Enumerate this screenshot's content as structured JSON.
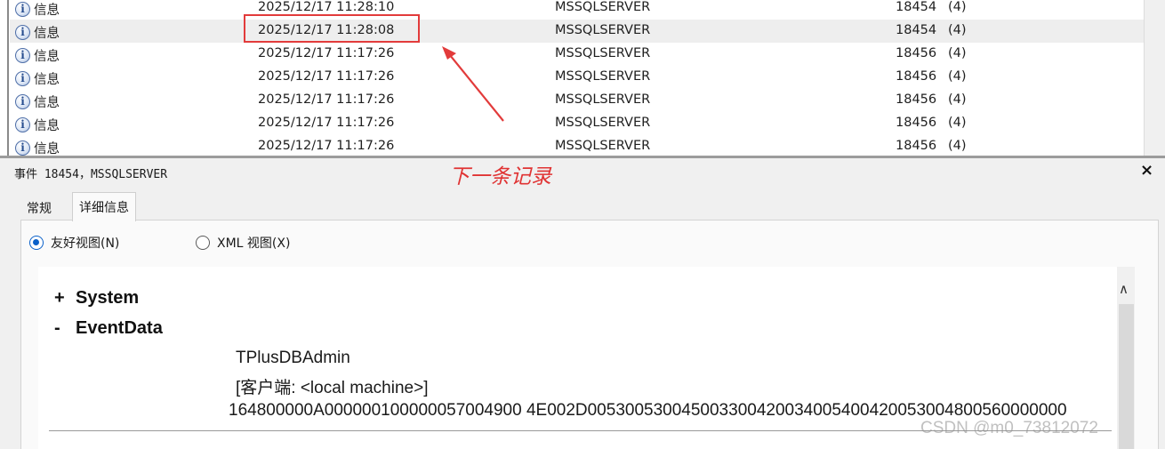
{
  "event_list": {
    "rows": [
      {
        "level": "信息",
        "datetime": "2025/12/17 11:28:10",
        "source": "MSSQLSERVER",
        "event_id": "18454",
        "task": "(4)"
      },
      {
        "level": "信息",
        "datetime": "2025/12/17 11:28:08",
        "source": "MSSQLSERVER",
        "event_id": "18454",
        "task": "(4)"
      },
      {
        "level": "信息",
        "datetime": "2025/12/17 11:17:26",
        "source": "MSSQLSERVER",
        "event_id": "18456",
        "task": "(4)"
      },
      {
        "level": "信息",
        "datetime": "2025/12/17 11:17:26",
        "source": "MSSQLSERVER",
        "event_id": "18456",
        "task": "(4)"
      },
      {
        "level": "信息",
        "datetime": "2025/12/17 11:17:26",
        "source": "MSSQLSERVER",
        "event_id": "18456",
        "task": "(4)"
      },
      {
        "level": "信息",
        "datetime": "2025/12/17 11:17:26",
        "source": "MSSQLSERVER",
        "event_id": "18456",
        "task": "(4)"
      },
      {
        "level": "信息",
        "datetime": "2025/12/17 11:17:26",
        "source": "MSSQLSERVER",
        "event_id": "18456",
        "task": "(4)"
      }
    ],
    "level_icon": "info-icon"
  },
  "annotation": {
    "text": "下一条记录",
    "color": "#e03333"
  },
  "detail": {
    "title": "事件 18454，MSSQLSERVER",
    "close_label": "×",
    "tabs": [
      {
        "label": "常规"
      },
      {
        "label": "详细信息"
      }
    ],
    "views": {
      "friendly": "友好视图(N)",
      "xml": "XML 视图(X)"
    },
    "tree": {
      "system": {
        "sign": "+",
        "label": "System"
      },
      "event_data": {
        "sign": "-",
        "label": "EventData"
      }
    },
    "event_data_lines": [
      "TPlusDBAdmin",
      "[客户端: <local machine>]",
      "164800000A000000100000057004900 4E002D005300530045003300420034005400420053004800560000000"
    ]
  },
  "watermark": "CSDN @m0_73812072"
}
